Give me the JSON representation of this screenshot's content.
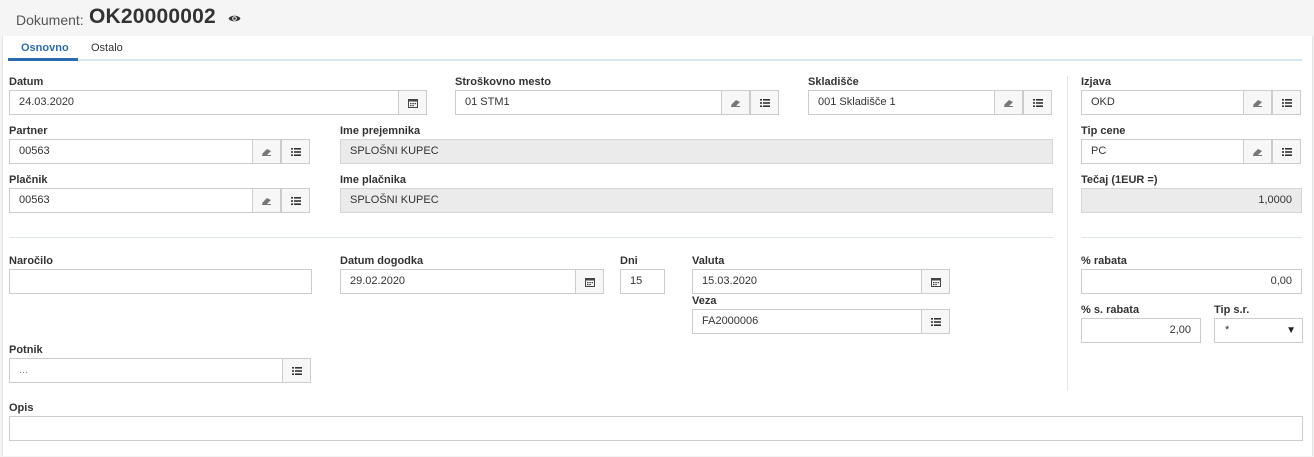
{
  "header": {
    "label": "Dokument:",
    "number": "OK20000002"
  },
  "tabs": [
    {
      "label": "Osnovno",
      "active": true
    },
    {
      "label": "Ostalo",
      "active": false
    }
  ],
  "fields": {
    "datum": {
      "label": "Datum",
      "value": "24.03.2020"
    },
    "strosko": {
      "label": "Stroškovno mesto",
      "value": "01 STM1"
    },
    "skladisce": {
      "label": "Skladišče",
      "value": "001 Skladišče 1"
    },
    "izjava": {
      "label": "Izjava",
      "value": "OKD"
    },
    "partner": {
      "label": "Partner",
      "value": "00563"
    },
    "ime_prejemnika": {
      "label": "Ime prejemnika",
      "value": "SPLOŠNI KUPEC"
    },
    "tip_cene": {
      "label": "Tip cene",
      "value": "PC"
    },
    "placnik": {
      "label": "Plačnik",
      "value": "00563"
    },
    "ime_placnika": {
      "label": "Ime plačnika",
      "value": "SPLOŠNI KUPEC"
    },
    "tecaj": {
      "label": "Tečaj (1EUR =)",
      "value": "1,0000"
    },
    "narocilo": {
      "label": "Naročilo",
      "value": ""
    },
    "datum_dogodka": {
      "label": "Datum dogodka",
      "value": "29.02.2020"
    },
    "dni": {
      "label": "Dni",
      "value": "15"
    },
    "valuta": {
      "label": "Valuta",
      "value": "15.03.2020"
    },
    "rabat": {
      "label": "% rabata",
      "value": "0,00"
    },
    "veza": {
      "label": "Veza",
      "value": "FA2000006"
    },
    "s_rabat": {
      "label": "% s. rabata",
      "value": "2,00"
    },
    "tip_sr": {
      "label": "Tip s.r.",
      "value": "*"
    },
    "potnik": {
      "label": "Potnik",
      "placeholder": "..."
    },
    "opis": {
      "label": "Opis",
      "value": ""
    }
  },
  "colors": {
    "accent": "#2b6cb0",
    "readonly_bg": "#ebebeb"
  }
}
